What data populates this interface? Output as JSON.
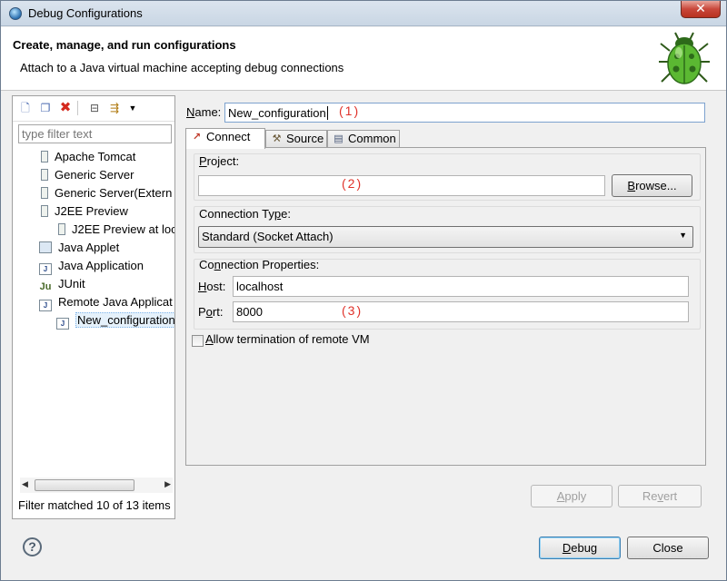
{
  "window": {
    "title": "Debug Configurations",
    "close_glyph": "✕"
  },
  "header": {
    "title": "Create, manage, and run configurations",
    "subtitle": "Attach to a Java virtual machine accepting debug connections",
    "icon": "bug-icon"
  },
  "left_panel": {
    "filter_placeholder": "type filter text",
    "tree": [
      {
        "label": "Apache Tomcat",
        "icon": "server-icon"
      },
      {
        "label": "Generic Server",
        "icon": "server-icon"
      },
      {
        "label": "Generic Server(Extern",
        "icon": "server-icon"
      },
      {
        "label": "J2EE Preview",
        "icon": "server-icon"
      },
      {
        "label": "J2EE Preview at loc",
        "icon": "server-icon"
      },
      {
        "label": "Java Applet",
        "icon": "applet-icon"
      },
      {
        "label": "Java Application",
        "icon": "java-app-icon"
      },
      {
        "label": "JUnit",
        "icon": "junit-icon"
      },
      {
        "label": "Remote Java Applicat",
        "icon": "remote-java-icon"
      },
      {
        "label": "New_configuration",
        "icon": "remote-config-icon",
        "selected": true
      }
    ],
    "status": "Filter matched 10 of 13 items"
  },
  "form": {
    "name_label": "Name:",
    "name_value": "New_configuration",
    "annotation_1": "(1)",
    "annotation_2": "(2)",
    "annotation_3": "(3)",
    "tabs": [
      {
        "label": "Connect",
        "icon": "connect-icon",
        "active": true
      },
      {
        "label": "Source",
        "icon": "source-icon",
        "active": false
      },
      {
        "label": "Common",
        "icon": "common-icon",
        "active": false
      }
    ],
    "project_label": "Project:",
    "project_value": "",
    "browse_label": "Browse...",
    "connection_type_label": "Connection Type:",
    "connection_type_value": "Standard (Socket Attach)",
    "connection_props_label": "Connection Properties:",
    "host_label": "Host:",
    "host_value": "localhost",
    "port_label": "Port:",
    "port_value": "8000",
    "allow_termination_label": "Allow termination of remote VM",
    "allow_termination_checked": false,
    "apply_label": "Apply",
    "revert_label": "Revert"
  },
  "footer": {
    "help_glyph": "?",
    "debug_label": "Debug",
    "close_label": "Close"
  }
}
